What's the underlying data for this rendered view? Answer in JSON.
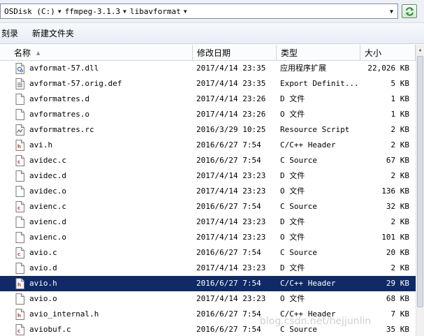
{
  "address": {
    "segments": [
      "OSDisk (C:)",
      "ffmpeg-3.1.3",
      "libavformat"
    ]
  },
  "toolbar": {
    "burn_label": "刻录",
    "new_folder_label": "新建文件夹"
  },
  "columns": {
    "name": "名称",
    "date": "修改日期",
    "type": "类型",
    "size": "大小"
  },
  "files": [
    {
      "name": "avformat-57.dll",
      "date": "2017/4/14 23:35",
      "type": "应用程序扩展",
      "size": "22,026 KB",
      "icon": "dll-file-icon"
    },
    {
      "name": "avformat-57.orig.def",
      "date": "2017/4/14 23:35",
      "type": "Export Definit...",
      "size": "5 KB",
      "icon": "def-file-icon"
    },
    {
      "name": "avformatres.d",
      "date": "2017/4/14 23:26",
      "type": "D 文件",
      "size": "1 KB",
      "icon": "blank-file-icon"
    },
    {
      "name": "avformatres.o",
      "date": "2017/4/14 23:26",
      "type": "O 文件",
      "size": "1 KB",
      "icon": "blank-file-icon"
    },
    {
      "name": "avformatres.rc",
      "date": "2016/3/29 10:25",
      "type": "Resource Script",
      "size": "2 KB",
      "icon": "rc-file-icon"
    },
    {
      "name": "avi.h",
      "date": "2016/6/27 7:54",
      "type": "C/C++ Header",
      "size": "2 KB",
      "icon": "header-file-icon"
    },
    {
      "name": "avidec.c",
      "date": "2016/6/27 7:54",
      "type": "C Source",
      "size": "67 KB",
      "icon": "c-source-file-icon"
    },
    {
      "name": "avidec.d",
      "date": "2017/4/14 23:23",
      "type": "D 文件",
      "size": "2 KB",
      "icon": "blank-file-icon"
    },
    {
      "name": "avidec.o",
      "date": "2017/4/14 23:23",
      "type": "O 文件",
      "size": "136 KB",
      "icon": "blank-file-icon"
    },
    {
      "name": "avienc.c",
      "date": "2016/6/27 7:54",
      "type": "C Source",
      "size": "32 KB",
      "icon": "c-source-file-icon"
    },
    {
      "name": "avienc.d",
      "date": "2017/4/14 23:23",
      "type": "D 文件",
      "size": "2 KB",
      "icon": "blank-file-icon"
    },
    {
      "name": "avienc.o",
      "date": "2017/4/14 23:23",
      "type": "O 文件",
      "size": "101 KB",
      "icon": "blank-file-icon"
    },
    {
      "name": "avio.c",
      "date": "2016/6/27 7:54",
      "type": "C Source",
      "size": "20 KB",
      "icon": "c-source-file-icon"
    },
    {
      "name": "avio.d",
      "date": "2017/4/14 23:23",
      "type": "D 文件",
      "size": "2 KB",
      "icon": "blank-file-icon"
    },
    {
      "name": "avio.h",
      "date": "2016/6/27 7:54",
      "type": "C/C++ Header",
      "size": "29 KB",
      "icon": "header-file-icon",
      "selected": true
    },
    {
      "name": "avio.o",
      "date": "2017/4/14 23:23",
      "type": "O 文件",
      "size": "68 KB",
      "icon": "blank-file-icon"
    },
    {
      "name": "avio_internal.h",
      "date": "2016/6/27 7:54",
      "type": "C/C++ Header",
      "size": "7 KB",
      "icon": "header-file-icon"
    },
    {
      "name": "aviobuf.c",
      "date": "2016/6/27 7:54",
      "type": "C Source",
      "size": "35 KB",
      "icon": "c-source-file-icon"
    }
  ],
  "watermark": "blog.csdn.net/hejjunlin",
  "colors": {
    "selection": "#0f2a66",
    "file_icon_accent": "#b04040"
  }
}
